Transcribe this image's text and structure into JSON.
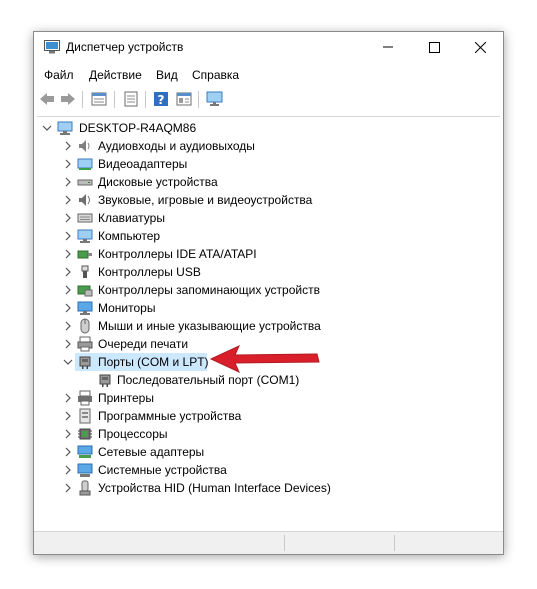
{
  "window": {
    "title": "Диспетчер устройств"
  },
  "menu": [
    {
      "label": "Файл"
    },
    {
      "label": "Действие"
    },
    {
      "label": "Вид"
    },
    {
      "label": "Справка"
    }
  ],
  "toolbar_icons": [
    "back-icon",
    "forward-icon",
    "properties-grid-icon",
    "document-icon",
    "help-icon",
    "properties-icon",
    "scan-monitor-icon"
  ],
  "tree": {
    "root": "DESKTOP-R4AQM86",
    "items": [
      {
        "label": "Аудиовходы и аудиовыходы",
        "icon": "speaker-icon"
      },
      {
        "label": "Видеоадаптеры",
        "icon": "display-adapter-icon"
      },
      {
        "label": "Дисковые устройства",
        "icon": "disk-drive-icon"
      },
      {
        "label": "Звуковые, игровые и видеоустройства",
        "icon": "sound-icon"
      },
      {
        "label": "Клавиатуры",
        "icon": "keyboard-icon"
      },
      {
        "label": "Компьютер",
        "icon": "computer-icon"
      },
      {
        "label": "Контроллеры IDE ATA/ATAPI",
        "icon": "ide-controller-icon"
      },
      {
        "label": "Контроллеры USB",
        "icon": "usb-icon"
      },
      {
        "label": "Контроллеры запоминающих устройств",
        "icon": "storage-controller-icon"
      },
      {
        "label": "Мониторы",
        "icon": "monitor-icon"
      },
      {
        "label": "Мыши и иные указывающие устройства",
        "icon": "mouse-icon"
      },
      {
        "label": "Очереди печати",
        "icon": "print-queue-icon"
      },
      {
        "label": "Порты (COM и LPT)",
        "icon": "port-icon",
        "expanded": true,
        "selected": true
      },
      {
        "label": "Последовательный порт (COM1)",
        "icon": "port-icon",
        "child": true
      },
      {
        "label": "Принтеры",
        "icon": "printer-icon"
      },
      {
        "label": "Программные устройства",
        "icon": "software-device-icon"
      },
      {
        "label": "Процессоры",
        "icon": "processor-icon"
      },
      {
        "label": "Сетевые адаптеры",
        "icon": "network-adapter-icon"
      },
      {
        "label": "Системные устройства",
        "icon": "system-device-icon"
      },
      {
        "label": "Устройства HID (Human Interface Devices)",
        "icon": "hid-icon"
      }
    ]
  },
  "colors": {
    "selection": "#cce8ff",
    "annotation_arrow": "#d9202a"
  }
}
